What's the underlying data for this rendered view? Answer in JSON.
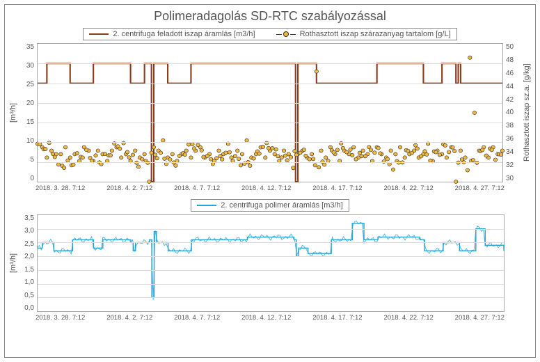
{
  "title": "Polimeradagolás SD-RTC szabályozással",
  "topChart": {
    "legend": [
      "2. centrifuga feladott iszap áramlás [m3/h]",
      "Rothasztott iszap szárazanyag tartalom [g/L]"
    ],
    "colors": {
      "series1": "#8b3a1a",
      "series2_marker": "#f0b840",
      "series2_stem": "#222"
    },
    "yLeft": {
      "label": "[m³/h]",
      "min": 0,
      "max": 35,
      "ticks": [
        0,
        5,
        10,
        15,
        20,
        25,
        30,
        35
      ]
    },
    "yRight": {
      "label": "Rothasztott iszap sz.a. [g/kg]",
      "min": 30,
      "max": 50,
      "ticks": [
        30,
        32,
        34,
        36,
        38,
        40,
        42,
        44,
        46,
        48,
        50
      ]
    }
  },
  "bottomChart": {
    "legend": [
      "2. centrifuga polimer áramlás [m3/h]"
    ],
    "colors": {
      "series1": "#2aa4d6"
    },
    "yLeft": {
      "label": "[m³/h]",
      "min": 0,
      "max": 3.5,
      "ticks": [
        "0,0",
        "0,5",
        "1,0",
        "1,5",
        "2,0",
        "2,5",
        "3,0",
        "3,5"
      ]
    }
  },
  "xTicks": [
    "2018. 3. 28. 7:12",
    "2018. 4. 2. 7:12",
    "2018. 4. 7. 7:12",
    "2018. 4. 12. 7:12",
    "2018. 4. 17. 7:12",
    "2018. 4. 22. 7:12",
    "2018. 4. 27. 7:12"
  ],
  "chart_data": [
    {
      "type": "line",
      "title": "Polimeradagolás SD-RTC szabályozással (felső)",
      "x_range": [
        "2018-03-28 07:12",
        "2018-04-27 07:12"
      ],
      "series": [
        {
          "name": "2. centrifuga feladott iszap áramlás [m3/h]",
          "axis": "left",
          "unit": "m3/h",
          "color": "#8b3a1a",
          "note": "Lépcsős jel, ~25 és ~30 m3/h között vált, kb. 2018-04-15 körül rövid nullára esés.",
          "x": [
            0,
            0.02,
            0.05,
            0.07,
            0.1,
            0.12,
            0.14,
            0.2,
            0.21,
            0.23,
            0.24,
            0.245,
            0.25,
            0.27,
            0.28,
            0.3,
            0.33,
            0.35,
            0.55,
            0.555,
            0.56,
            0.59,
            0.6,
            0.72,
            0.73,
            0.82,
            0.83,
            0.86,
            0.87,
            0.89,
            0.9,
            0.905,
            0.91,
            1.0
          ],
          "y": [
            25,
            30,
            30,
            25,
            25,
            30,
            30,
            25,
            25,
            30,
            30,
            0,
            30,
            30,
            25,
            25,
            30,
            30,
            30,
            0,
            30,
            30,
            25,
            25,
            30,
            30,
            25,
            25,
            30,
            30,
            25,
            30,
            25,
            25
          ]
        },
        {
          "name": "Rothasztott iszap szárazanyag tartalom [g/L]",
          "axis": "right",
          "unit": "g/L",
          "color_marker": "#f0b840",
          "color_line": "#222",
          "note": "Sűrű mintavételű zajos sorozat, tipikus tartomány 32–36 g/L, néhány kiugró 44–48 körül.",
          "typical_min": 31,
          "typical_max": 36,
          "outliers_approx": [
            {
              "x_frac": 0.24,
              "y": 30
            },
            {
              "x_frac": 0.6,
              "y": 46
            },
            {
              "x_frac": 0.93,
              "y": 48
            },
            {
              "x_frac": 0.94,
              "y": 40
            },
            {
              "x_frac": 0.9,
              "y": 30
            }
          ],
          "sample": [
            {
              "x_frac": 0.0,
              "y": 35.5
            },
            {
              "x_frac": 0.01,
              "y": 35
            },
            {
              "x_frac": 0.02,
              "y": 33.5
            },
            {
              "x_frac": 0.03,
              "y": 34.5
            },
            {
              "x_frac": 0.04,
              "y": 34
            },
            {
              "x_frac": 0.045,
              "y": 32.5
            },
            {
              "x_frac": 0.05,
              "y": 34
            },
            {
              "x_frac": 0.06,
              "y": 35
            },
            {
              "x_frac": 0.07,
              "y": 33.5
            },
            {
              "x_frac": 0.08,
              "y": 34
            },
            {
              "x_frac": 0.09,
              "y": 33
            },
            {
              "x_frac": 0.1,
              "y": 35
            },
            {
              "x_frac": 0.11,
              "y": 34.5
            },
            {
              "x_frac": 0.12,
              "y": 33
            },
            {
              "x_frac": 0.13,
              "y": 34.5
            },
            {
              "x_frac": 0.14,
              "y": 34
            },
            {
              "x_frac": 0.15,
              "y": 33
            },
            {
              "x_frac": 0.16,
              "y": 34.5
            },
            {
              "x_frac": 0.17,
              "y": 35
            },
            {
              "x_frac": 0.18,
              "y": 33.5
            },
            {
              "x_frac": 0.19,
              "y": 34
            },
            {
              "x_frac": 0.2,
              "y": 33
            },
            {
              "x_frac": 0.21,
              "y": 34.5
            },
            {
              "x_frac": 0.22,
              "y": 33.5
            },
            {
              "x_frac": 0.23,
              "y": 34
            },
            {
              "x_frac": 0.24,
              "y": 30
            },
            {
              "x_frac": 0.25,
              "y": 35
            },
            {
              "x_frac": 0.26,
              "y": 34.5
            },
            {
              "x_frac": 0.27,
              "y": 36
            },
            {
              "x_frac": 0.28,
              "y": 33.5
            },
            {
              "x_frac": 0.29,
              "y": 34
            },
            {
              "x_frac": 0.3,
              "y": 33
            },
            {
              "x_frac": 0.31,
              "y": 34
            },
            {
              "x_frac": 0.32,
              "y": 34.5
            },
            {
              "x_frac": 0.33,
              "y": 33.5
            },
            {
              "x_frac": 0.34,
              "y": 34.5
            },
            {
              "x_frac": 0.35,
              "y": 35
            },
            {
              "x_frac": 0.36,
              "y": 33.5
            },
            {
              "x_frac": 0.37,
              "y": 34
            },
            {
              "x_frac": 0.38,
              "y": 33
            },
            {
              "x_frac": 0.39,
              "y": 34.5
            },
            {
              "x_frac": 0.4,
              "y": 34
            },
            {
              "x_frac": 0.41,
              "y": 35.5
            },
            {
              "x_frac": 0.42,
              "y": 33
            },
            {
              "x_frac": 0.43,
              "y": 34.5
            },
            {
              "x_frac": 0.44,
              "y": 34
            },
            {
              "x_frac": 0.45,
              "y": 36
            },
            {
              "x_frac": 0.46,
              "y": 33.5
            },
            {
              "x_frac": 0.47,
              "y": 34
            },
            {
              "x_frac": 0.48,
              "y": 35
            },
            {
              "x_frac": 0.49,
              "y": 33.5
            },
            {
              "x_frac": 0.5,
              "y": 34.5
            },
            {
              "x_frac": 0.51,
              "y": 34
            },
            {
              "x_frac": 0.52,
              "y": 33
            },
            {
              "x_frac": 0.53,
              "y": 34.5
            },
            {
              "x_frac": 0.54,
              "y": 34
            },
            {
              "x_frac": 0.55,
              "y": 32
            },
            {
              "x_frac": 0.56,
              "y": 34
            },
            {
              "x_frac": 0.57,
              "y": 34.5
            },
            {
              "x_frac": 0.58,
              "y": 33.5
            },
            {
              "x_frac": 0.59,
              "y": 34
            },
            {
              "x_frac": 0.6,
              "y": 46
            },
            {
              "x_frac": 0.61,
              "y": 34.5
            },
            {
              "x_frac": 0.62,
              "y": 33.5
            },
            {
              "x_frac": 0.63,
              "y": 35
            },
            {
              "x_frac": 0.64,
              "y": 34
            },
            {
              "x_frac": 0.65,
              "y": 33
            },
            {
              "x_frac": 0.66,
              "y": 34.5
            },
            {
              "x_frac": 0.67,
              "y": 34
            },
            {
              "x_frac": 0.68,
              "y": 35
            },
            {
              "x_frac": 0.69,
              "y": 33.5
            },
            {
              "x_frac": 0.7,
              "y": 34.5
            },
            {
              "x_frac": 0.71,
              "y": 34
            },
            {
              "x_frac": 0.72,
              "y": 33
            },
            {
              "x_frac": 0.73,
              "y": 35
            },
            {
              "x_frac": 0.74,
              "y": 34
            },
            {
              "x_frac": 0.75,
              "y": 33.5
            },
            {
              "x_frac": 0.76,
              "y": 34.5
            },
            {
              "x_frac": 0.77,
              "y": 34
            },
            {
              "x_frac": 0.78,
              "y": 35
            },
            {
              "x_frac": 0.79,
              "y": 33.5
            },
            {
              "x_frac": 0.8,
              "y": 34
            },
            {
              "x_frac": 0.81,
              "y": 34.5
            },
            {
              "x_frac": 0.82,
              "y": 33.5
            },
            {
              "x_frac": 0.83,
              "y": 34
            },
            {
              "x_frac": 0.84,
              "y": 35.5
            },
            {
              "x_frac": 0.85,
              "y": 33
            },
            {
              "x_frac": 0.86,
              "y": 34.5
            },
            {
              "x_frac": 0.87,
              "y": 34
            },
            {
              "x_frac": 0.88,
              "y": 33.5
            },
            {
              "x_frac": 0.89,
              "y": 35
            },
            {
              "x_frac": 0.9,
              "y": 30
            },
            {
              "x_frac": 0.91,
              "y": 34.5
            },
            {
              "x_frac": 0.92,
              "y": 33.5
            },
            {
              "x_frac": 0.93,
              "y": 48
            },
            {
              "x_frac": 0.94,
              "y": 40
            },
            {
              "x_frac": 0.95,
              "y": 34.5
            },
            {
              "x_frac": 0.96,
              "y": 35
            },
            {
              "x_frac": 0.97,
              "y": 33.5
            },
            {
              "x_frac": 0.98,
              "y": 35
            },
            {
              "x_frac": 0.99,
              "y": 34
            },
            {
              "x_frac": 1.0,
              "y": 34.5
            }
          ]
        }
      ],
      "y_left_range": [
        0,
        35
      ],
      "y_right_range": [
        30,
        50
      ]
    },
    {
      "type": "line",
      "title": "2. centrifuga polimer áramlás",
      "x_range": [
        "2018-03-28 07:12",
        "2018-04-27 07:12"
      ],
      "series": [
        {
          "name": "2. centrifuga polimer áramlás [m3/h]",
          "axis": "left",
          "unit": "m3/h",
          "color": "#2aa4d6",
          "note": "Jellemzően 2,0–2,8 m3/h tartomány, egy nagy leesés ~0,5 körül 2018-04-02-nél, csúcs ~3,2 2018-04-19 körül.",
          "x": [
            0,
            0.01,
            0.03,
            0.035,
            0.07,
            0.075,
            0.1,
            0.12,
            0.14,
            0.2,
            0.205,
            0.21,
            0.24,
            0.245,
            0.25,
            0.255,
            0.27,
            0.28,
            0.31,
            0.33,
            0.35,
            0.4,
            0.45,
            0.5,
            0.55,
            0.555,
            0.56,
            0.58,
            0.6,
            0.63,
            0.67,
            0.675,
            0.7,
            0.72,
            0.73,
            0.8,
            0.82,
            0.83,
            0.86,
            0.87,
            0.9,
            0.905,
            0.92,
            0.94,
            0.96,
            1.0
          ],
          "y": [
            2.3,
            2.5,
            2.5,
            2.2,
            2.2,
            2.6,
            2.6,
            2.3,
            2.6,
            2.5,
            2.2,
            2.5,
            2.6,
            0.5,
            2.9,
            2.5,
            2.5,
            2.2,
            2.2,
            2.6,
            2.6,
            2.6,
            2.7,
            2.7,
            2.6,
            2.0,
            2.3,
            2.1,
            2.1,
            2.6,
            2.6,
            3.2,
            2.6,
            2.6,
            2.7,
            2.7,
            2.6,
            2.2,
            2.2,
            2.5,
            2.5,
            2.2,
            2.2,
            3.0,
            2.4,
            2.2
          ]
        }
      ],
      "y_left_range": [
        0,
        3.5
      ]
    }
  ]
}
